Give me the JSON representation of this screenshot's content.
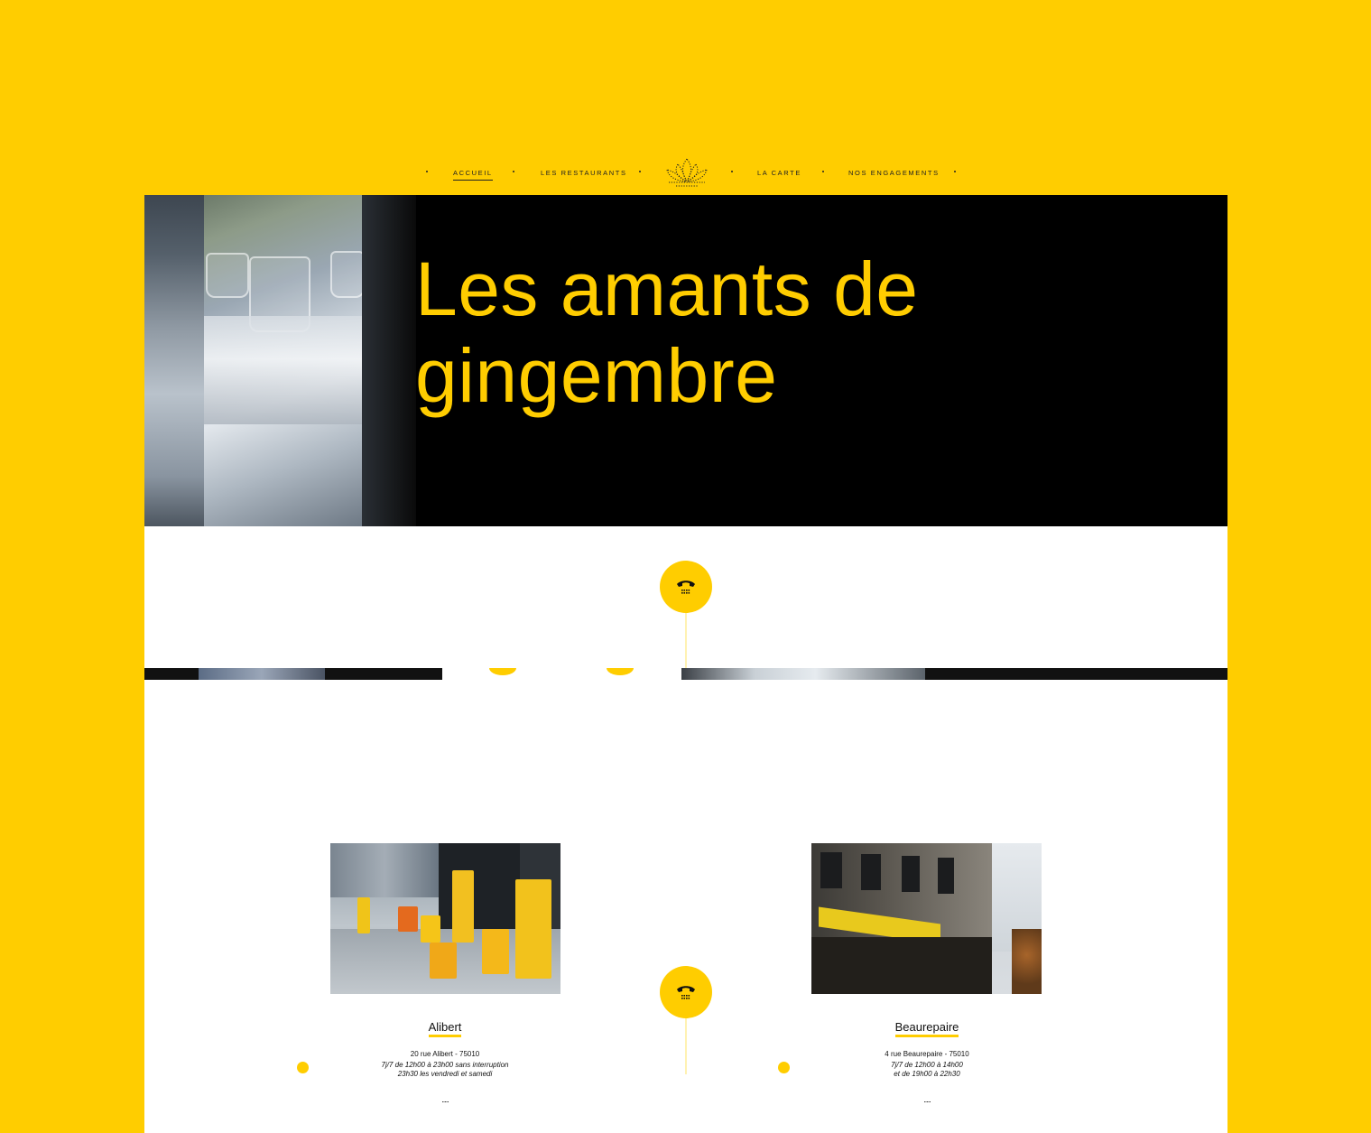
{
  "nav": {
    "items": [
      "Accueil",
      "Les restaurants",
      "La carte",
      "Nos engagements"
    ],
    "active": "Accueil",
    "logo_icon": "lotus-logo-icon"
  },
  "hero": {
    "title": "Les amants de gingembre"
  },
  "phone_icon": "phone-icon",
  "restaurants": [
    {
      "name": "Alibert",
      "address": "20 rue Alibert - 75010",
      "hours_line1": "7j/7 de 12h00 à 23h00 sans interruption",
      "hours_line2": "23h30 les vendredi et samedi",
      "more": "....."
    },
    {
      "name": "Beaurepaire",
      "address": "4 rue Beaurepaire - 75010",
      "hours_line1": "7j/7 de 12h00 à 14h00",
      "hours_line2": "et de 19h00 à 22h30",
      "more": "....."
    }
  ],
  "colors": {
    "brand_yellow": "#ffcd00",
    "hero_bg": "#000000",
    "page_bg": "#ffffff"
  }
}
